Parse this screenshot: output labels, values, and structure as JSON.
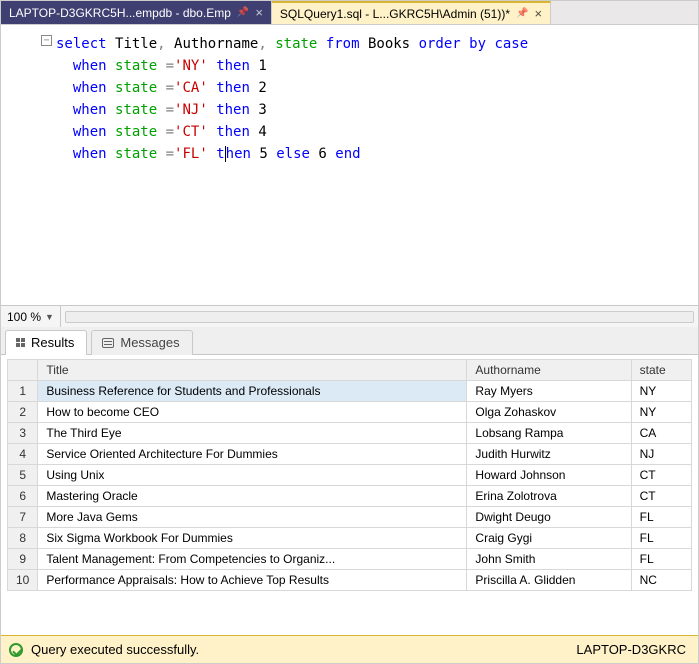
{
  "tabs": {
    "inactive_label": "LAPTOP-D3GKRC5H...empdb - dbo.Emp",
    "active_label": "SQLQuery1.sql - L...GKRC5H\\Admin (51))*"
  },
  "editor": {
    "outline_glyph": "−",
    "lines": [
      [
        [
          "kw",
          "select"
        ],
        [
          "",
          ""
        ],
        [
          "",
          "Title"
        ],
        [
          "op",
          ","
        ],
        [
          "",
          ""
        ],
        [
          "",
          "Authorname"
        ],
        [
          "op",
          ","
        ],
        [
          "",
          ""
        ],
        [
          "id",
          "state"
        ],
        [
          "",
          ""
        ],
        [
          "kw",
          "from"
        ],
        [
          "",
          ""
        ],
        [
          "",
          "Books"
        ],
        [
          "",
          ""
        ],
        [
          "kw",
          "order"
        ],
        [
          "",
          ""
        ],
        [
          "kw",
          "by"
        ],
        [
          "",
          ""
        ],
        [
          "kw",
          "case"
        ]
      ],
      [
        [
          "",
          "  "
        ],
        [
          "kw",
          "when"
        ],
        [
          "",
          ""
        ],
        [
          "id",
          "state"
        ],
        [
          "",
          ""
        ],
        [
          "op",
          "="
        ],
        [
          "str",
          "'NY'"
        ],
        [
          "",
          ""
        ],
        [
          "kw",
          "then"
        ],
        [
          "",
          ""
        ],
        [
          "num",
          "1"
        ]
      ],
      [
        [
          "",
          "  "
        ],
        [
          "kw",
          "when"
        ],
        [
          "",
          ""
        ],
        [
          "id",
          "state"
        ],
        [
          "",
          ""
        ],
        [
          "op",
          "="
        ],
        [
          "str",
          "'CA'"
        ],
        [
          "",
          ""
        ],
        [
          "kw",
          "then"
        ],
        [
          "",
          ""
        ],
        [
          "num",
          "2"
        ]
      ],
      [
        [
          "",
          "  "
        ],
        [
          "kw",
          "when"
        ],
        [
          "",
          ""
        ],
        [
          "id",
          "state"
        ],
        [
          "",
          ""
        ],
        [
          "op",
          "="
        ],
        [
          "str",
          "'NJ'"
        ],
        [
          "",
          ""
        ],
        [
          "kw",
          "then"
        ],
        [
          "",
          ""
        ],
        [
          "num",
          "3"
        ]
      ],
      [
        [
          "",
          "  "
        ],
        [
          "kw",
          "when"
        ],
        [
          "",
          ""
        ],
        [
          "id",
          "state"
        ],
        [
          "",
          ""
        ],
        [
          "op",
          "="
        ],
        [
          "str",
          "'CT'"
        ],
        [
          "",
          ""
        ],
        [
          "kw",
          "then"
        ],
        [
          "",
          ""
        ],
        [
          "num",
          "4"
        ]
      ],
      [
        [
          "",
          "  "
        ],
        [
          "kw",
          "when"
        ],
        [
          "",
          ""
        ],
        [
          "id",
          "state"
        ],
        [
          "",
          ""
        ],
        [
          "op",
          "="
        ],
        [
          "str",
          "'FL'"
        ],
        [
          "",
          ""
        ],
        [
          "kw",
          "t"
        ],
        [
          "cursor",
          ""
        ],
        [
          "kw",
          "hen"
        ],
        [
          "",
          ""
        ],
        [
          "num",
          "5"
        ],
        [
          "",
          ""
        ],
        [
          "kw",
          "else"
        ],
        [
          "",
          ""
        ],
        [
          "num",
          "6"
        ],
        [
          "",
          ""
        ],
        [
          "kw",
          "end"
        ]
      ]
    ]
  },
  "zoom": {
    "value": "100 %"
  },
  "panel_tabs": {
    "results": "Results",
    "messages": "Messages"
  },
  "grid": {
    "headers": {
      "row": "",
      "title": "Title",
      "author": "Authorname",
      "state": "state"
    },
    "rows": [
      {
        "n": "1",
        "title": "Business Reference for Students and Professionals",
        "author": "Ray Myers",
        "state": "NY",
        "selected": true
      },
      {
        "n": "2",
        "title": "How to become CEO",
        "author": "Olga Zohaskov",
        "state": "NY"
      },
      {
        "n": "3",
        "title": "The Third Eye",
        "author": "Lobsang Rampa",
        "state": "CA"
      },
      {
        "n": "4",
        "title": "Service Oriented Architecture For Dummies",
        "author": "Judith Hurwitz",
        "state": "NJ"
      },
      {
        "n": "5",
        "title": "Using Unix",
        "author": "Howard Johnson",
        "state": "CT"
      },
      {
        "n": "6",
        "title": "Mastering Oracle",
        "author": "Erina Zolotrova",
        "state": "CT"
      },
      {
        "n": "7",
        "title": "More Java Gems",
        "author": "Dwight Deugo",
        "state": "FL"
      },
      {
        "n": "8",
        "title": "Six Sigma Workbook For Dummies",
        "author": "Craig Gygi",
        "state": "FL"
      },
      {
        "n": "9",
        "title": "Talent Management: From Competencies to Organiz...",
        "author": "John Smith",
        "state": "FL"
      },
      {
        "n": "10",
        "title": "Performance Appraisals: How to Achieve Top Results",
        "author": "Priscilla A. Glidden",
        "state": "NC"
      }
    ]
  },
  "status": {
    "message": "Query executed successfully.",
    "server": "LAPTOP-D3GKRC"
  }
}
